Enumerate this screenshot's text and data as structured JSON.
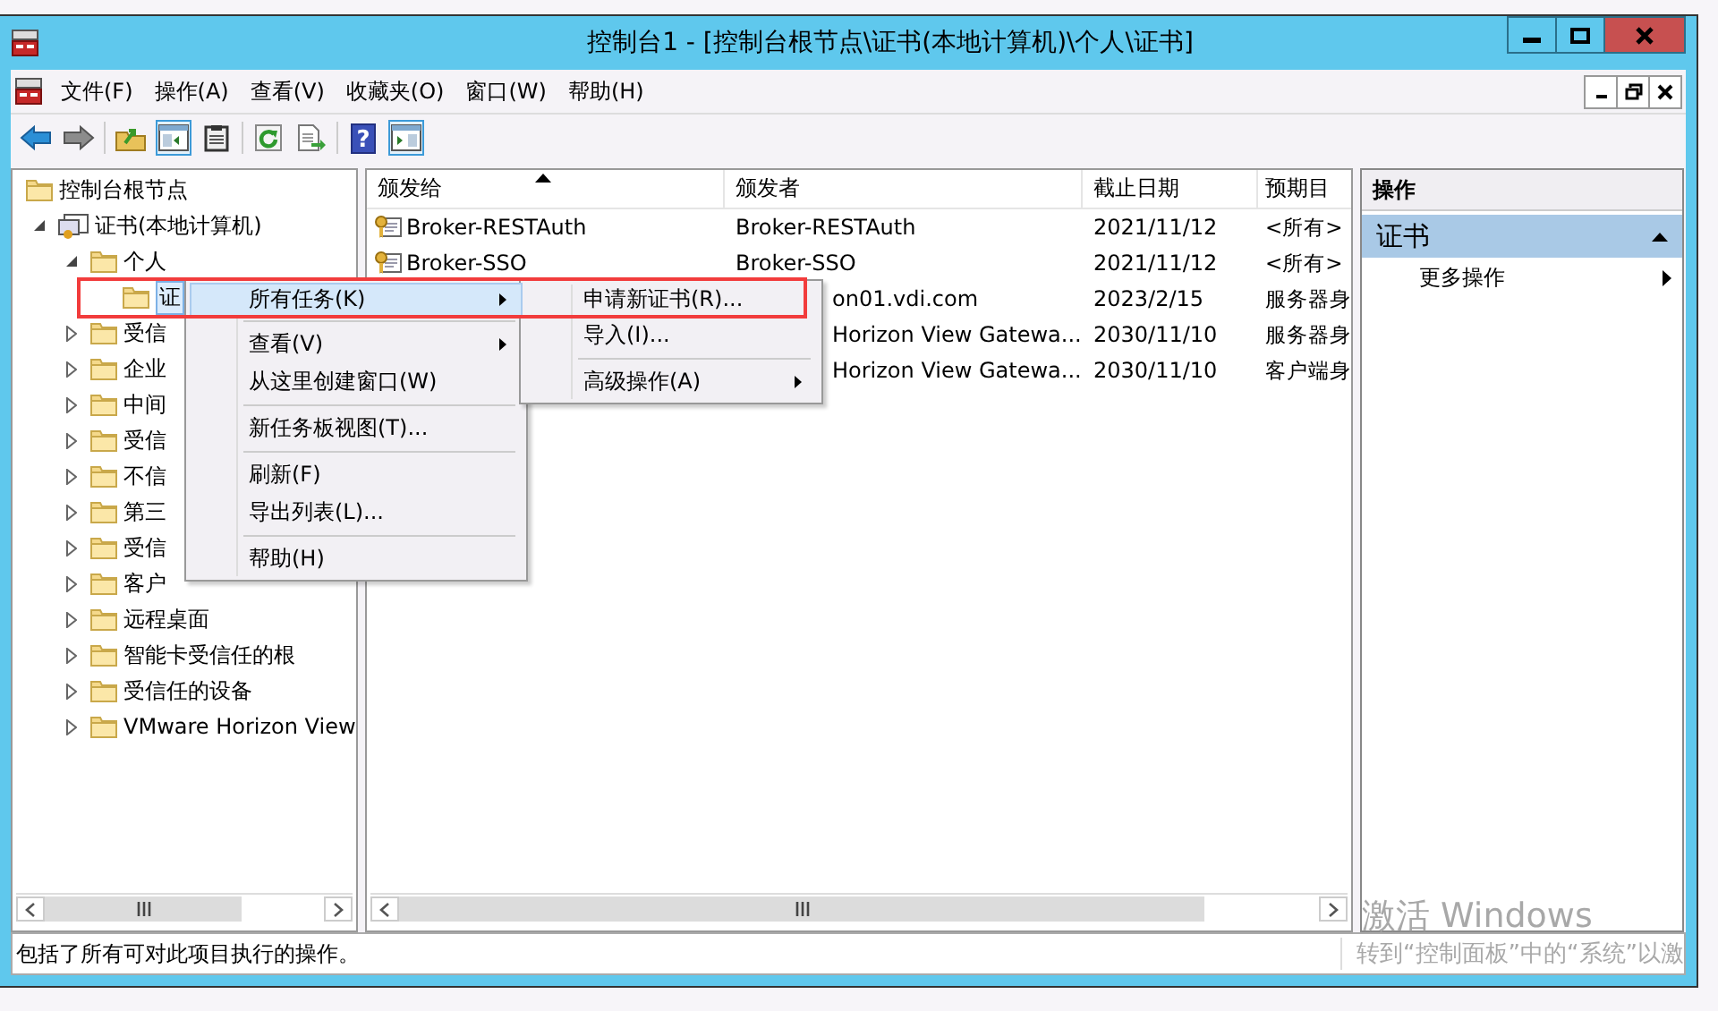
{
  "window": {
    "title": "控制台1 - [控制台根节点\\证书(本地计算机)\\个人\\证书]"
  },
  "menu_bar": [
    "文件(F)",
    "操作(A)",
    "查看(V)",
    "收藏夹(O)",
    "窗口(W)",
    "帮助(H)"
  ],
  "toolbar": [
    {
      "kind": "back",
      "pressed": false
    },
    {
      "kind": "forward",
      "pressed": false
    },
    {
      "kind": "sep"
    },
    {
      "kind": "up",
      "pressed": false
    },
    {
      "kind": "tree",
      "pressed": true
    },
    {
      "kind": "clipboard",
      "pressed": false
    },
    {
      "kind": "sep"
    },
    {
      "kind": "refresh",
      "pressed": false
    },
    {
      "kind": "export",
      "pressed": false
    },
    {
      "kind": "sep"
    },
    {
      "kind": "help",
      "glyph": "?",
      "pressed": false
    },
    {
      "kind": "actionpane",
      "pressed": true
    }
  ],
  "tree": [
    {
      "label": "控制台根节点",
      "kind": "folder",
      "children": [
        {
          "label": "证书(本地计算机)",
          "kind": "store",
          "expanded": true,
          "children": [
            {
              "label": "个人",
              "kind": "folder",
              "expanded": true,
              "children": [
                {
                  "label": "证",
                  "kind": "folder",
                  "selected": true
                }
              ]
            },
            {
              "label": "受信",
              "kind": "folder",
              "expanded": false
            },
            {
              "label": "企业",
              "kind": "folder",
              "expanded": false
            },
            {
              "label": "中间",
              "kind": "folder",
              "expanded": false
            },
            {
              "label": "受信",
              "kind": "folder",
              "expanded": false
            },
            {
              "label": "不信",
              "kind": "folder",
              "expanded": false
            },
            {
              "label": "第三",
              "kind": "folder",
              "expanded": false
            },
            {
              "label": "受信",
              "kind": "folder",
              "expanded": false
            },
            {
              "label": "客户",
              "kind": "folder",
              "expanded": false
            },
            {
              "label": "远程桌面",
              "kind": "folder",
              "expanded": false
            },
            {
              "label": "智能卡受信任的根",
              "kind": "folder",
              "expanded": false
            },
            {
              "label": "受信任的设备",
              "kind": "folder",
              "expanded": false
            },
            {
              "label": "VMware Horizon View",
              "kind": "folder",
              "expanded": false
            }
          ]
        }
      ]
    }
  ],
  "table": {
    "columns": [
      {
        "label": "颁发给",
        "sorted": true
      },
      {
        "label": "颁发者",
        "sorted": false
      },
      {
        "label": "截止日期",
        "sorted": false
      },
      {
        "label": "预期目",
        "sorted": false
      }
    ],
    "rows": [
      {
        "issued_to": "Broker-RESTAuth",
        "issuer": "Broker-RESTAuth",
        "expires": "2021/11/12",
        "purpose": "<所有>"
      },
      {
        "issued_to": "Broker-SSO",
        "issuer": "Broker-SSO",
        "expires": "2021/11/12",
        "purpose": "<所有>"
      },
      {
        "issuer": "on01.vdi.com",
        "partial": true,
        "expires": "2023/2/15",
        "purpose": "服务器身"
      },
      {
        "issuer": "Horizon View Gatewa...",
        "partial": true,
        "expires": "2030/11/10",
        "purpose": "服务器身"
      },
      {
        "issuer": "Horizon View Gatewa...",
        "partial": true,
        "expires": "2030/11/10",
        "purpose": "客户端身"
      }
    ]
  },
  "actions_pane": {
    "header": "操作",
    "section": {
      "title": "证书",
      "expanded": true
    },
    "items": [
      {
        "label": "更多操作",
        "submenu": true
      }
    ]
  },
  "context_menu": {
    "items": [
      {
        "kind": "item",
        "label": "所有任务(K)",
        "submenu": true,
        "selected": true
      },
      {
        "kind": "separator"
      },
      {
        "kind": "item",
        "label": "查看(V)",
        "submenu": true,
        "selected": false
      },
      {
        "kind": "item",
        "label": "从这里创建窗口(W)",
        "submenu": false,
        "selected": false
      },
      {
        "kind": "separator"
      },
      {
        "kind": "item",
        "label": "新任务板视图(T)...",
        "submenu": false,
        "selected": false
      },
      {
        "kind": "separator"
      },
      {
        "kind": "item",
        "label": "刷新(F)",
        "submenu": false,
        "selected": false
      },
      {
        "kind": "item",
        "label": "导出列表(L)...",
        "submenu": false,
        "selected": false
      },
      {
        "kind": "separator"
      },
      {
        "kind": "item",
        "label": "帮助(H)",
        "submenu": false,
        "selected": false
      }
    ]
  },
  "submenu": {
    "items": [
      {
        "kind": "item",
        "label": "申请新证书(R)...",
        "submenu": false,
        "selected": false
      },
      {
        "kind": "item",
        "label": "导入(I)...",
        "submenu": false,
        "selected": false
      },
      {
        "kind": "separator"
      },
      {
        "kind": "item",
        "label": "高级操作(A)",
        "submenu": true,
        "selected": false
      }
    ]
  },
  "status_bar": "包括了所有可对此项目执行的操作。",
  "activation_notice": {
    "title": "激活 Windows",
    "text": "转到“控制面板”中的“系统”以激"
  }
}
